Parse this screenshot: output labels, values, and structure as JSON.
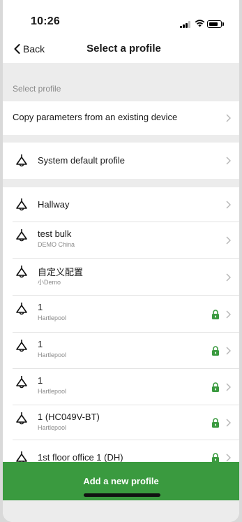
{
  "status_bar": {
    "time": "10:26"
  },
  "nav": {
    "back_label": "Back",
    "title": "Select a profile"
  },
  "section_label": "Select profile",
  "copy_row": {
    "label": "Copy parameters from an existing device"
  },
  "default_row": {
    "label": "System default profile"
  },
  "profiles": [
    {
      "title": "Hallway",
      "subtitle": "",
      "locked": false
    },
    {
      "title": "test bulk",
      "subtitle": "DEMO China",
      "locked": false
    },
    {
      "title": "自定义配置",
      "subtitle": "小Demo",
      "locked": false
    },
    {
      "title": "1",
      "subtitle": "Hartlepool",
      "locked": true
    },
    {
      "title": "1",
      "subtitle": "Hartlepool",
      "locked": true
    },
    {
      "title": "1",
      "subtitle": "Hartlepool",
      "locked": true
    },
    {
      "title": "1 (HC049V-BT)",
      "subtitle": "Hartlepool",
      "locked": true
    },
    {
      "title": "1st floor office 1 (DH)",
      "subtitle": "",
      "locked": true
    }
  ],
  "add_button": {
    "label": "Add a new profile"
  },
  "colors": {
    "accent": "#3a9a3f",
    "lock": "#3a9a3f",
    "section_bg": "#ececec"
  },
  "icons": {
    "profile": "ceiling-lamp-icon",
    "row": "chevron-right-icon",
    "locked": "lock-icon"
  }
}
